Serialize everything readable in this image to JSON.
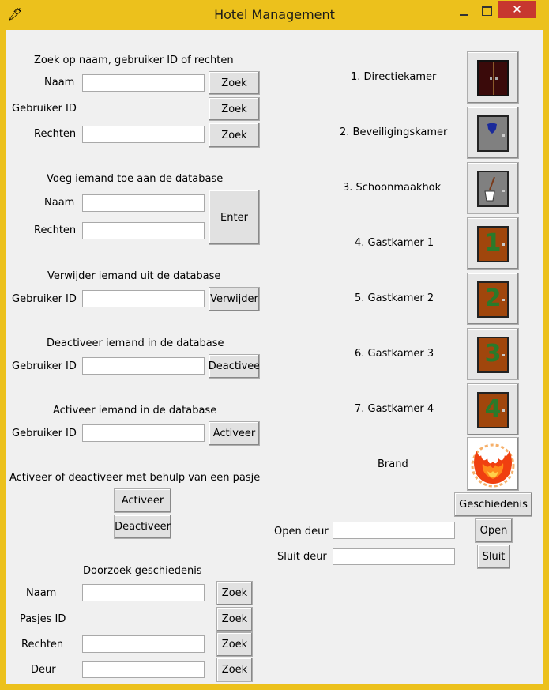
{
  "window": {
    "title": "Hotel Management",
    "close_glyph": "✕"
  },
  "search": {
    "heading": "Zoek op naam, gebruiker ID of rechten",
    "name_label": "Naam",
    "id_label": "Gebruiker ID",
    "rights_label": "Rechten",
    "button": "Zoek"
  },
  "add": {
    "heading": "Voeg iemand toe aan de database",
    "name_label": "Naam",
    "rights_label": "Rechten",
    "button": "Enter"
  },
  "remove": {
    "heading": "Verwijder iemand uit de database",
    "id_label": "Gebruiker ID",
    "button": "Verwijder"
  },
  "deactivate": {
    "heading": "Deactiveer iemand in de database",
    "id_label": "Gebruiker ID",
    "button": "Deactivee"
  },
  "activate": {
    "heading": "Activeer iemand in de database",
    "id_label": "Gebruiker ID",
    "button": "Activeer"
  },
  "card": {
    "heading": "Activeer of deactiveer met behulp van een pasje",
    "activate_button": "Activeer",
    "deactivate_button": "Deactiveer"
  },
  "history_search": {
    "heading": "Doorzoek geschiedenis",
    "name_label": "Naam",
    "card_label": "Pasjes ID",
    "rights_label": "Rechten",
    "door_label": "Deur",
    "button": "Zoek"
  },
  "rooms": [
    {
      "label": "1. Directiekamer",
      "icon": "double-door-icon",
      "color": "#3a0a0a"
    },
    {
      "label": "2. Beveiligingskamer",
      "icon": "security-door-icon",
      "color": "#808080"
    },
    {
      "label": "3. Schoonmaakhok",
      "icon": "cleaning-door-icon",
      "color": "#808080"
    },
    {
      "label": "4. Gastkamer 1",
      "icon": "guestroom-door-icon",
      "color": "#a0460c",
      "digit": "1"
    },
    {
      "label": "5. Gastkamer 2",
      "icon": "guestroom-door-icon",
      "color": "#a0460c",
      "digit": "2"
    },
    {
      "label": "6. Gastkamer 3",
      "icon": "guestroom-door-icon",
      "color": "#a0460c",
      "digit": "3"
    },
    {
      "label": "7. Gastkamer 4",
      "icon": "guestroom-door-icon",
      "color": "#a0460c",
      "digit": "4"
    }
  ],
  "fire": {
    "label": "Brand",
    "icon": "fire-icon"
  },
  "history_button": "Geschiedenis",
  "door_control": {
    "open_label": "Open deur",
    "open_button": "Open",
    "close_label": "Sluit deur",
    "close_button": "Sluit"
  }
}
